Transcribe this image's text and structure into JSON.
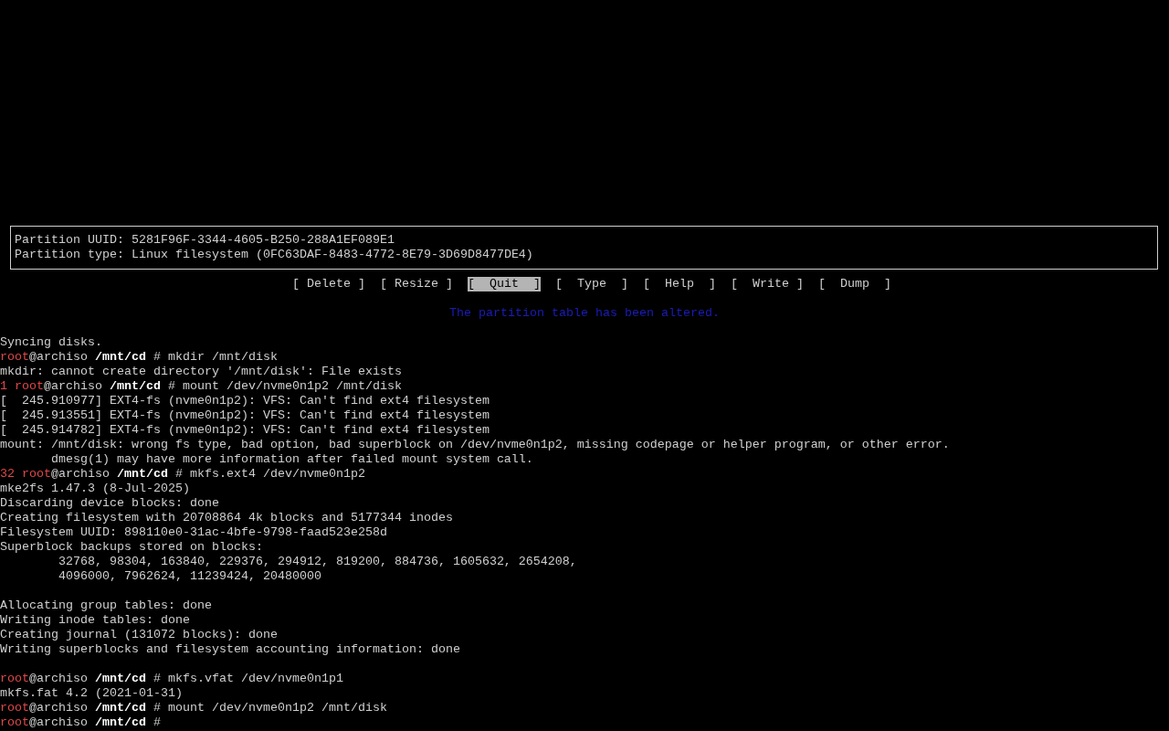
{
  "partition_info": [
    "Partition UUID: 5281F96F-3344-4605-B250-288A1EF089E1",
    "Partition type: Linux filesystem (0FC63DAF-8483-4772-8E79-3D69D8477DE4)"
  ],
  "menu": [
    {
      "label": "[ Delete ]",
      "selected": false
    },
    {
      "label": "[ Resize ]",
      "selected": false
    },
    {
      "label": "[  Quit  ]",
      "selected": true
    },
    {
      "label": "[  Type  ]",
      "selected": false
    },
    {
      "label": "[  Help  ]",
      "selected": false
    },
    {
      "label": "[  Write ]",
      "selected": false
    },
    {
      "label": "[  Dump  ]",
      "selected": false
    }
  ],
  "status_message": "The partition table has been altered.",
  "terminal": [
    {
      "kind": "output",
      "text": "Syncing disks."
    },
    {
      "kind": "prompt",
      "user": "root",
      "host": "@archiso",
      "cwd": "/mnt/cd",
      "symbol": "#",
      "command": "mkdir /mnt/disk"
    },
    {
      "kind": "output",
      "text": "mkdir: cannot create directory '/mnt/disk': File exists"
    },
    {
      "kind": "prompt",
      "status": "1",
      "user": "root",
      "host": "@archiso",
      "cwd": "/mnt/cd",
      "symbol": "#",
      "command": "mount /dev/nvme0n1p2 /mnt/disk"
    },
    {
      "kind": "output",
      "text": "[  245.910977] EXT4-fs (nvme0n1p2): VFS: Can't find ext4 filesystem"
    },
    {
      "kind": "output",
      "text": "[  245.913551] EXT4-fs (nvme0n1p2): VFS: Can't find ext4 filesystem"
    },
    {
      "kind": "output",
      "text": "[  245.914782] EXT4-fs (nvme0n1p2): VFS: Can't find ext4 filesystem"
    },
    {
      "kind": "output",
      "text": "mount: /mnt/disk: wrong fs type, bad option, bad superblock on /dev/nvme0n1p2, missing codepage or helper program, or other error."
    },
    {
      "kind": "output",
      "text": "       dmesg(1) may have more information after failed mount system call."
    },
    {
      "kind": "prompt",
      "status": "32",
      "user": "root",
      "host": "@archiso",
      "cwd": "/mnt/cd",
      "symbol": "#",
      "command": "mkfs.ext4 /dev/nvme0n1p2"
    },
    {
      "kind": "output",
      "text": "mke2fs 1.47.3 (8-Jul-2025)"
    },
    {
      "kind": "output",
      "text": "Discarding device blocks: done"
    },
    {
      "kind": "output",
      "text": "Creating filesystem with 20708864 4k blocks and 5177344 inodes"
    },
    {
      "kind": "output",
      "text": "Filesystem UUID: 898110e0-31ac-4bfe-9798-faad523e258d"
    },
    {
      "kind": "output",
      "text": "Superblock backups stored on blocks:"
    },
    {
      "kind": "output",
      "text": "        32768, 98304, 163840, 229376, 294912, 819200, 884736, 1605632, 2654208,"
    },
    {
      "kind": "output",
      "text": "        4096000, 7962624, 11239424, 20480000"
    },
    {
      "kind": "blank"
    },
    {
      "kind": "output",
      "text": "Allocating group tables: done"
    },
    {
      "kind": "output",
      "text": "Writing inode tables: done"
    },
    {
      "kind": "output",
      "text": "Creating journal (131072 blocks): done"
    },
    {
      "kind": "output",
      "text": "Writing superblocks and filesystem accounting information: done"
    },
    {
      "kind": "blank"
    },
    {
      "kind": "prompt",
      "user": "root",
      "host": "@archiso",
      "cwd": "/mnt/cd",
      "symbol": "#",
      "command": "mkfs.vfat /dev/nvme0n1p1"
    },
    {
      "kind": "output",
      "text": "mkfs.fat 4.2 (2021-01-31)"
    },
    {
      "kind": "prompt",
      "user": "root",
      "host": "@archiso",
      "cwd": "/mnt/cd",
      "symbol": "#",
      "command": "mount /dev/nvme0n1p2 /mnt/disk"
    },
    {
      "kind": "prompt",
      "user": "root",
      "host": "@archiso",
      "cwd": "/mnt/cd",
      "symbol": "#"
    }
  ]
}
